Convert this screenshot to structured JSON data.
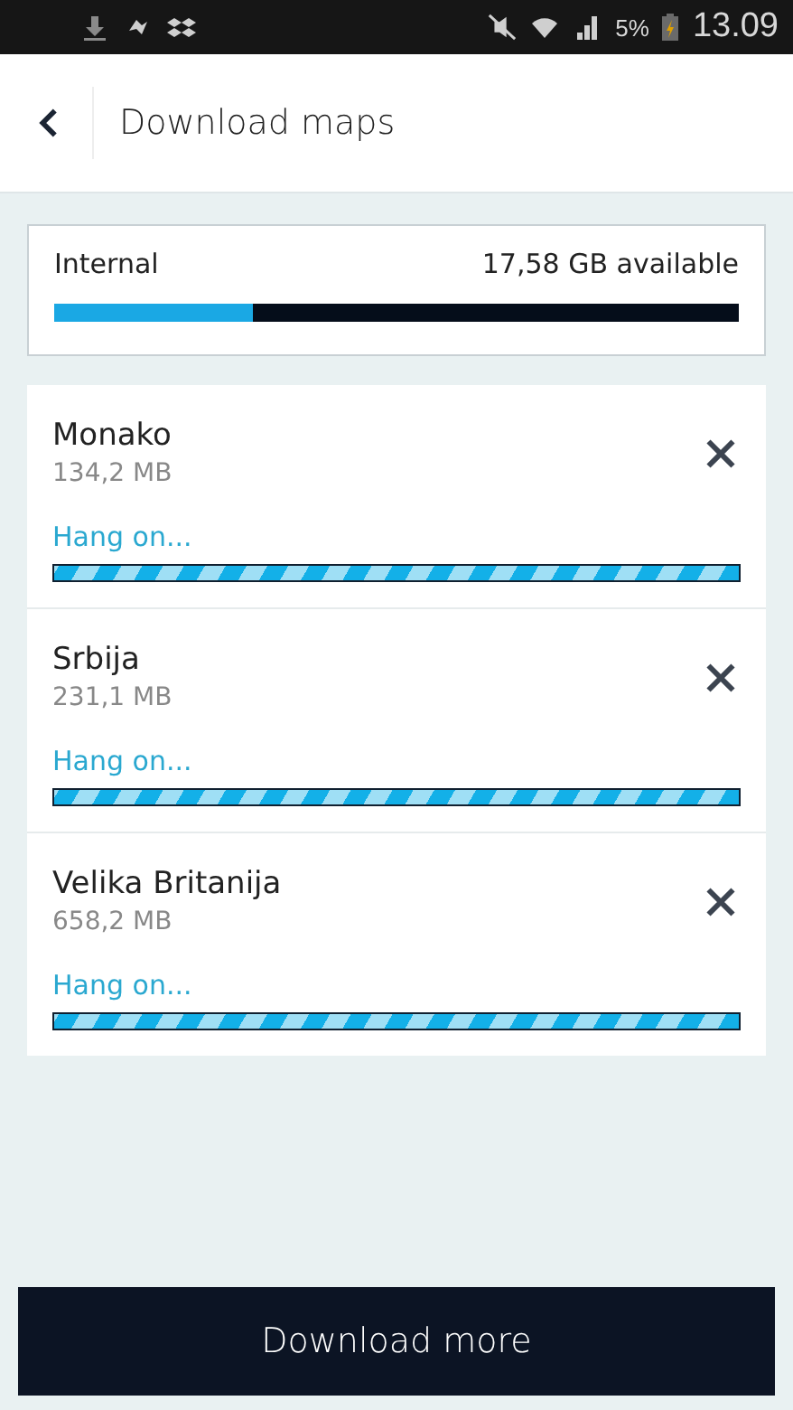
{
  "status_bar": {
    "battery": "5%",
    "time": "13.09"
  },
  "header": {
    "title": "Download maps"
  },
  "storage": {
    "label": "Internal",
    "available": "17,58 GB available",
    "level": 0.29
  },
  "downloads": [
    {
      "name": "Monako",
      "size": "134,2 MB",
      "status": "Hang on...",
      "level": 1
    },
    {
      "name": "Srbija",
      "size": "231,1 MB",
      "status": "Hang on...",
      "level": 1
    },
    {
      "name": "Velika Britanija",
      "size": "658,2 MB",
      "status": "Hang on...",
      "level": 1
    }
  ],
  "button": {
    "label": "Download more"
  }
}
